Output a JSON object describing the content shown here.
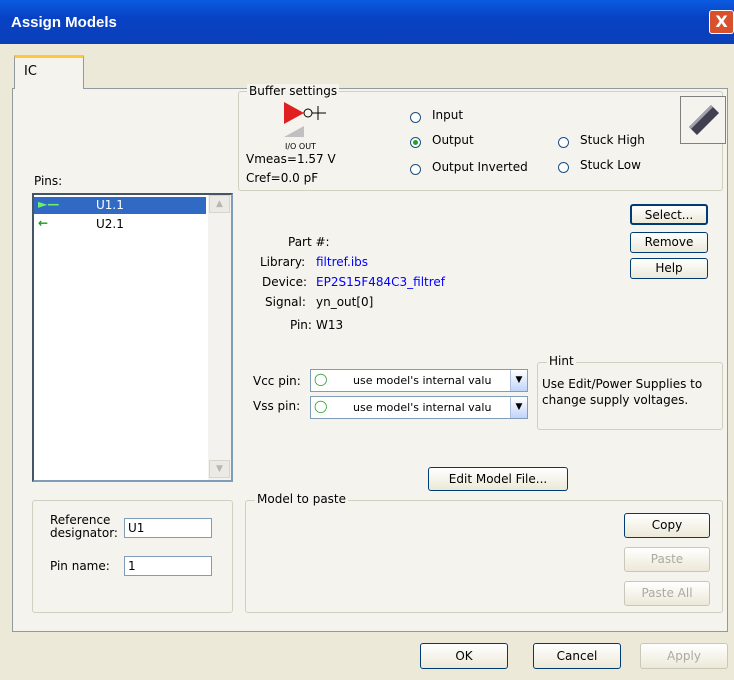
{
  "window": {
    "title": "Assign Models",
    "close_label": "X"
  },
  "tabs": [
    {
      "label": "IC"
    }
  ],
  "pins": {
    "label": "Pins:",
    "items": [
      {
        "name": "U1.1",
        "selected": true
      },
      {
        "name": "U2.1",
        "selected": false
      }
    ]
  },
  "buffer": {
    "legend": "Buffer settings",
    "io_label": "I/O OUT",
    "vmeas": "Vmeas=1.57 V",
    "cref": "Cref=0.0 pF",
    "options": {
      "input": "Input",
      "output": "Output",
      "output_inverted": "Output Inverted",
      "stuck_high": "Stuck High",
      "stuck_low": "Stuck Low"
    },
    "selected": "output"
  },
  "actions": {
    "select": "Select...",
    "remove": "Remove",
    "help": "Help"
  },
  "details": {
    "part_label": "Part #:",
    "part_value": "",
    "library_label": "Library:",
    "library_value": "filtref.ibs",
    "device_label": "Device:",
    "device_value": "EP2S15F484C3_filtref",
    "signal_label": "Signal:",
    "signal_value": "yn_out[0]",
    "pin_label": "Pin:",
    "pin_value": "W13"
  },
  "supply": {
    "vcc_label": "Vcc pin:",
    "vcc_value": "use model's internal valu",
    "vss_label": "Vss pin:",
    "vss_value": "use model's internal valu"
  },
  "hint": {
    "legend": "Hint",
    "text": "Use Edit/Power Supplies to change supply voltages."
  },
  "edit_model_label": "Edit Model File...",
  "paste": {
    "legend": "Model to paste",
    "copy": "Copy",
    "paste": "Paste",
    "paste_all": "Paste All"
  },
  "ref": {
    "designator_label": "Reference designator:",
    "designator_value": "U1",
    "pin_name_label": "Pin name:",
    "pin_name_value": "1"
  },
  "footer": {
    "ok": "OK",
    "cancel": "Cancel",
    "apply": "Apply"
  },
  "colors": {
    "accent": "#316ac5",
    "link": "#0000ff",
    "title_bar": "#0a5be0"
  }
}
